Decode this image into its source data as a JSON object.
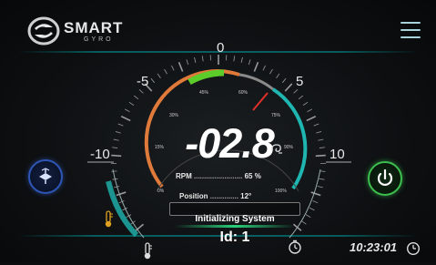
{
  "app": {
    "logo_text": "SMART",
    "logo_sub": "GYRO"
  },
  "gauge": {
    "value": "-02.8",
    "scale_labels": [
      "-10",
      "-5",
      "0",
      "5",
      "10"
    ],
    "pct_labels": [
      "0%",
      "15%",
      "30%",
      "45%",
      "60%",
      "75%",
      "90%",
      "100%"
    ]
  },
  "readouts": {
    "rpm_label": "RPM",
    "rpm_dots": "........................",
    "rpm_value": "65 %",
    "position_label": "Position",
    "position_dots": "..............",
    "position_value": "12°"
  },
  "status": {
    "text": "Initializing System",
    "id_text": "Id: 1"
  },
  "footer": {
    "time": "10:23:01"
  },
  "icons": {
    "menu": "hamburger-menu-icon",
    "gyro": "gyro-icon",
    "power": "power-icon",
    "thermometer": "thermometer-icon",
    "timer": "timer-icon",
    "clock": "clock-icon",
    "swirl": "swirl-icon"
  },
  "colors": {
    "accent_teal": "#1fb5b0",
    "arc_orange": "#e07a3a",
    "arc_green": "#5ccc2a",
    "power_green": "#3cbf4e",
    "gyro_blue": "#2e56b6"
  }
}
